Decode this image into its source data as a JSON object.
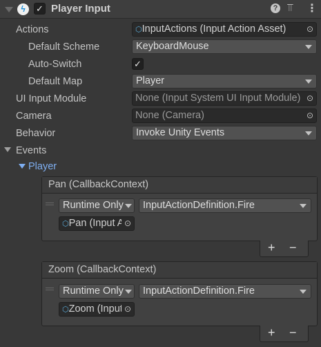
{
  "component": {
    "title": "Player Input",
    "enabled": true
  },
  "fields": {
    "actions": {
      "label": "Actions",
      "value": "InputActions (Input Action Asset)"
    },
    "default_scheme": {
      "label": "Default Scheme",
      "value": "KeyboardMouse"
    },
    "auto_switch": {
      "label": "Auto-Switch",
      "checked": true
    },
    "default_map": {
      "label": "Default Map",
      "value": "Player"
    },
    "ui_input_module": {
      "label": "UI Input Module",
      "value": "None (Input System UI Input Module)"
    },
    "camera": {
      "label": "Camera",
      "value": "None (Camera)"
    },
    "behavior": {
      "label": "Behavior",
      "value": "Invoke Unity Events"
    }
  },
  "events": {
    "label": "Events",
    "map": "Player",
    "items": [
      {
        "title": "Pan (CallbackContext)",
        "runtime": "Runtime Only",
        "function": "InputActionDefinition.Fire",
        "object": "Pan (Input Action Reference)"
      },
      {
        "title": "Zoom (CallbackContext)",
        "runtime": "Runtime Only",
        "function": "InputActionDefinition.Fire",
        "object": "Zoom (Input Action Reference)"
      }
    ]
  },
  "buttons": {
    "plus": "+",
    "minus": "−"
  },
  "colors": {
    "bg": "#383838",
    "link": "#7eaef0"
  }
}
